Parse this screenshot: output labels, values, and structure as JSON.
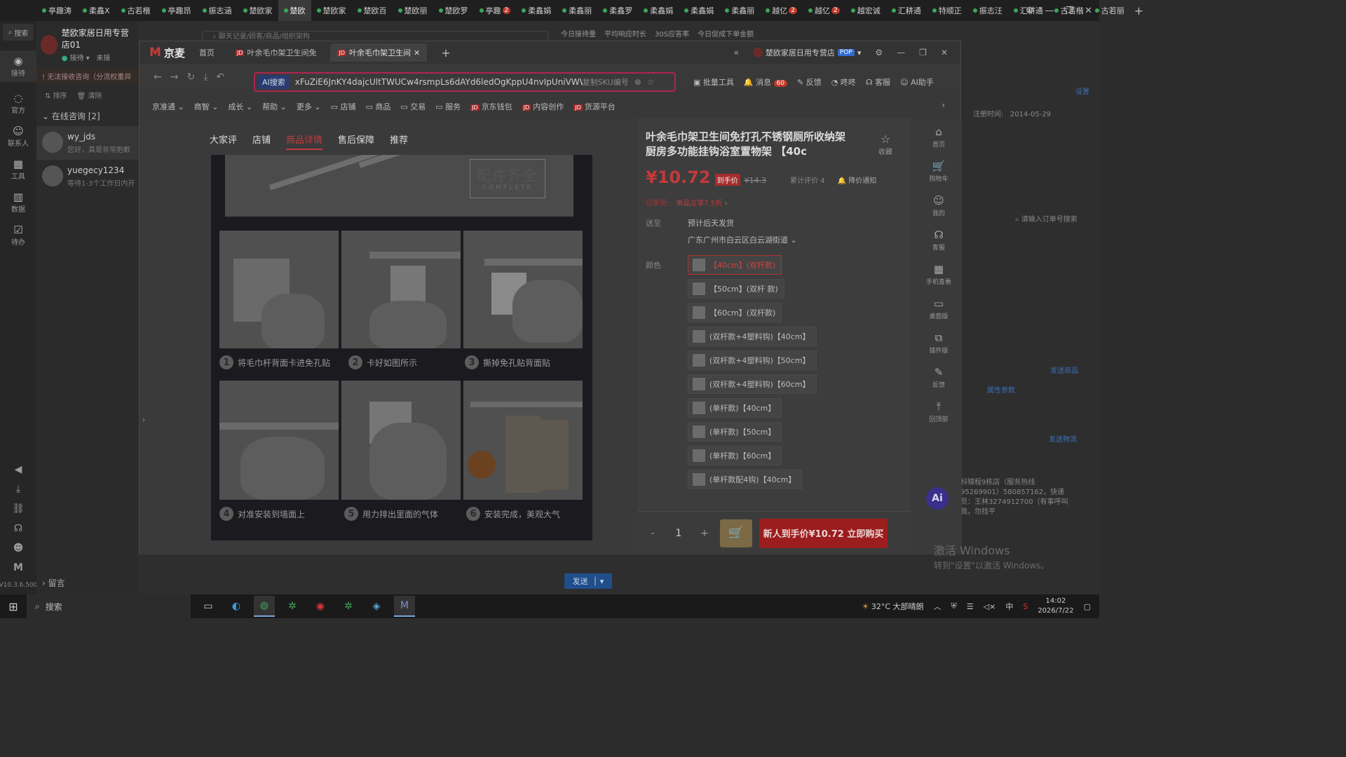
{
  "top_tabs": [
    {
      "label": "亭趣涛"
    },
    {
      "label": "柔鑫X"
    },
    {
      "label": "古若楷"
    },
    {
      "label": "亭趣昂"
    },
    {
      "label": "振志涵"
    },
    {
      "label": "楚欧家"
    },
    {
      "label": "楚欧",
      "active": true
    },
    {
      "label": "楚欧家"
    },
    {
      "label": "楚欧百"
    },
    {
      "label": "楚欧丽"
    },
    {
      "label": "楚欧罗"
    },
    {
      "label": "亭趣",
      "badge": "2"
    },
    {
      "label": "柔鑫娟"
    },
    {
      "label": "柔鑫丽"
    },
    {
      "label": "柔鑫罗"
    },
    {
      "label": "柔鑫娟"
    },
    {
      "label": "柔鑫娟"
    },
    {
      "label": "柔鑫丽"
    },
    {
      "label": "越亿",
      "badge": "2"
    },
    {
      "label": "越亿",
      "badge": "2"
    },
    {
      "label": "越宏诚"
    },
    {
      "label": "汇耕通"
    },
    {
      "label": "特顺正"
    },
    {
      "label": "振志汪"
    },
    {
      "label": "汇耕通"
    },
    {
      "label": "古若楷"
    },
    {
      "label": "古若丽"
    }
  ],
  "rail": {
    "search": "搜索",
    "items": [
      "接待",
      "官方",
      "联系人",
      "工具",
      "数据",
      "待办"
    ],
    "version": "V10.3.6.500"
  },
  "chat": {
    "shop_name": "楚欧家居日用专营店01",
    "status_receive": "接待",
    "status_other": "未接",
    "warning": "无法接收咨询（分流权重异",
    "sort": "排序",
    "clear": "清除",
    "group": "在线咨询 [2]",
    "items": [
      {
        "name": "wy_jds",
        "msg": "您好，真是非常抱歉"
      },
      {
        "name": "yuegecy1234",
        "msg": "等待1-3个工作日内开"
      }
    ],
    "leave": "留言",
    "send": "发送"
  },
  "bg": {
    "search_placeholder": "聊天记录/顾客/商品/组织架构",
    "stats": [
      "今日接待量",
      "平均响应时长",
      "30S应答率",
      "今日促成下单金额"
    ],
    "register_label": "注册时间:",
    "register_date": "2014-05-29",
    "settings": "设置",
    "order_search": "请输入订单号搜索",
    "send_product": "发送商品",
    "attr": "属性参数",
    "send_logistics": "发送物流",
    "address": "科锦程9栋店（服务热线95269901）580857162，快递员：王林3274912700（有事呼叫我，勿找平"
  },
  "jd": {
    "brand": "京麦",
    "tabs": [
      {
        "label": "首页"
      },
      {
        "label": "叶余毛巾架卫生间免"
      },
      {
        "label": "叶余毛巾架卫生间",
        "active": true
      }
    ],
    "shop_name": "楚欧家居日用专营店",
    "pop": "POP",
    "ai_search": "AI搜索",
    "url": "xFuZiE6JnKY4dajcUltTWUCw4rsmpLs6dAYd6ledOgKppU4nvIpUniVWWT9w",
    "copy_sku": "复制SKU编号",
    "tools": {
      "batch": "批量工具",
      "messages": "消息",
      "msg_count": "60",
      "feedback": "反馈",
      "dongdong": "咚咚",
      "service": "客服",
      "ai_helper": "AI助手"
    },
    "menu": [
      {
        "label": "京准通",
        "caret": true
      },
      {
        "label": "商智",
        "caret": true
      },
      {
        "label": "成长",
        "caret": true
      },
      {
        "label": "帮助",
        "caret": true
      },
      {
        "label": "更多",
        "caret": true
      },
      {
        "label": "店铺",
        "icon": "box"
      },
      {
        "label": "商品",
        "icon": "box"
      },
      {
        "label": "交易",
        "icon": "box"
      },
      {
        "label": "服务",
        "icon": "box"
      },
      {
        "label": "京东钱包",
        "icon": "jd"
      },
      {
        "label": "内容创作",
        "icon": "jd"
      },
      {
        "label": "货源平台",
        "icon": "jd"
      }
    ]
  },
  "product": {
    "tabs": [
      "大家评",
      "店铺",
      "商品详情",
      "售后保障",
      "推荐"
    ],
    "active_tab": "商品详情",
    "banner_cn": "配件齐全",
    "banner_en": "COMPLETE",
    "steps": [
      {
        "num": "1",
        "text": "将毛巾杆背面卡进免孔贴"
      },
      {
        "num": "2",
        "text": "卡好如图所示"
      },
      {
        "num": "3",
        "text": "撕掉免孔贴背面贴"
      },
      {
        "num": "4",
        "text": "对准安装到墙面上"
      },
      {
        "num": "5",
        "text": "用力排出里面的气体"
      },
      {
        "num": "6",
        "text": "安装完成，美观大气"
      }
    ],
    "title": "叶余毛巾架卫生间免打孔不锈钢厕所收纳架厨房多功能挂钩浴室置物架 【40c",
    "favorite": "收藏",
    "price": "¥10.72",
    "price_tag": "到手价",
    "orig_price": "¥14.3",
    "eval": "累计评价 4",
    "notify": "降价通知",
    "enjoy_label": "已享受:",
    "enjoy_value": "单品立享7.5折",
    "ship_label": "送至",
    "ship_value": "预计后天发货",
    "location": "广东广州市白云区白云湖街道",
    "color_label": "颜色",
    "options": [
      "【40cm】(双杆款)",
      "【50cm】(双杆 款)",
      "【60cm】(双杆款)",
      "(双杆款+4塑料钩)【40cm】",
      "(双杆款+4塑料钩)【50cm】",
      "(双杆款+4塑料钩)【60cm】",
      "(单杆款)【40cm】",
      "(单杆款)【50cm】",
      "(单杆款)【60cm】",
      "(单杆款配4钩)【40cm】"
    ],
    "selected_option": 0,
    "qty": "1",
    "buy_now": "新人到手价¥10.72 立即购买"
  },
  "sidenav": [
    "首页",
    "购物车",
    "我的",
    "客服",
    "手机查看",
    "桌面版",
    "插件版",
    "反馈",
    "回顶部"
  ],
  "watermark": {
    "line1": "激活 Windows",
    "line2": "转到\"设置\"以激活 Windows。"
  },
  "taskbar": {
    "search": "搜索",
    "weather": "32°C 大部晴朗",
    "ime": "中",
    "time": "14:02",
    "date": "2026/7/22"
  }
}
